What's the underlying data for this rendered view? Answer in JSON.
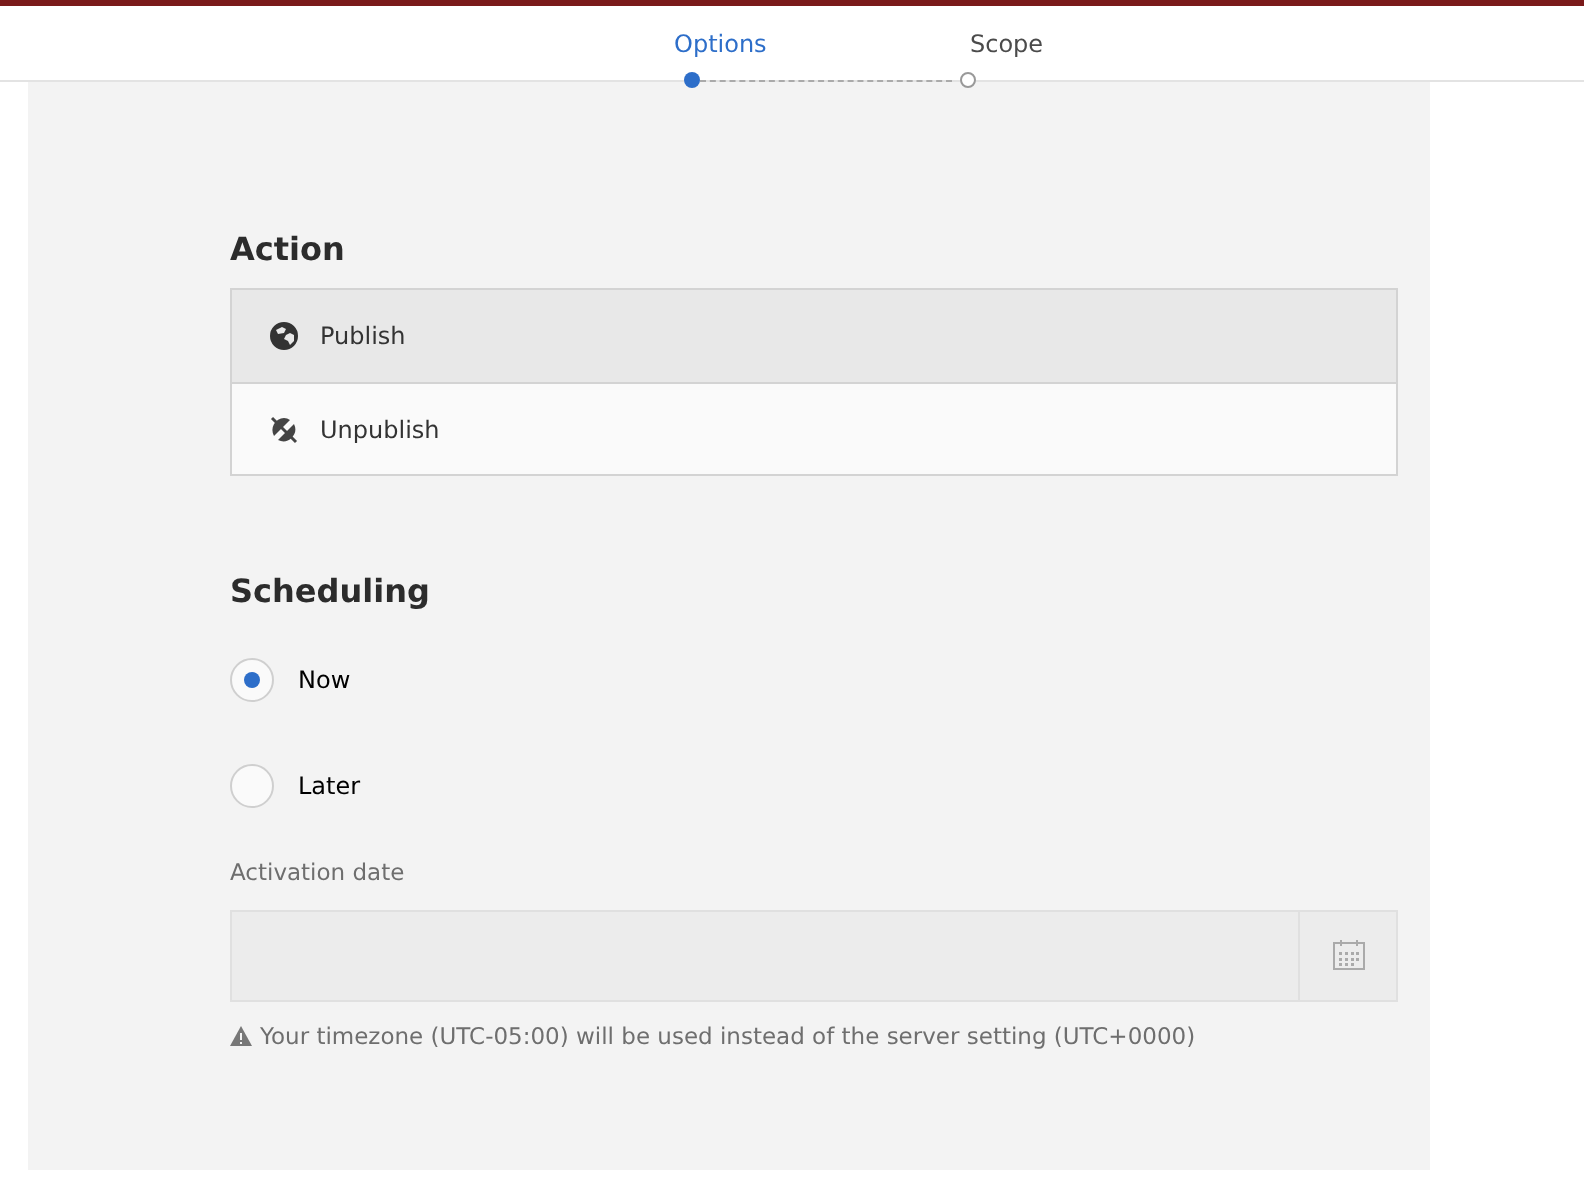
{
  "steps": [
    {
      "label": "Options",
      "selected": true
    },
    {
      "label": "Scope",
      "selected": false
    }
  ],
  "action": {
    "title": "Action",
    "items": [
      {
        "label": "Publish",
        "kind": "publish",
        "selected": true
      },
      {
        "label": "Unpublish",
        "kind": "unpublish",
        "selected": false
      }
    ]
  },
  "scheduling": {
    "title": "Scheduling",
    "options": [
      {
        "label": "Now",
        "selected": true
      },
      {
        "label": "Later",
        "selected": false
      }
    ]
  },
  "activation_date": {
    "label": "Activation date",
    "disabled": true
  },
  "warning": "Your timezone (UTC-05:00) will be used instead of the server setting (UTC+0000)"
}
